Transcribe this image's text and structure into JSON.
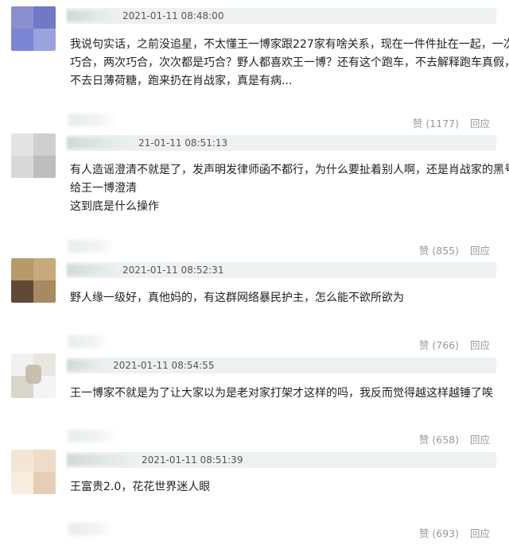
{
  "comments": [
    {
      "time": "2021-01-11 08:48:00",
      "lines": [
        "我说句实话，之前没追星，不太懂王一博家跟227家有啥关系，现在一件件扯在一起，一次",
        "巧合，两次巧合，次次都是巧合？野人都喜欢王一博？还有这个跑车，不去解释跑车真假，",
        "不去日薄荷糖，跑来扔在肖战家，真是有病..."
      ],
      "like_label": "赞",
      "like_count": "(1177)",
      "reply_label": "回应"
    },
    {
      "time": "21-01-11 08:51:13",
      "lines": [
        "有人造谣澄清不就是了，发声明发律师函不都行，为什么要扯着别人啊，还是肖战家的黑号",
        "给王一博澄清",
        "这到底是什么操作"
      ],
      "like_label": "赞",
      "like_count": "(855)",
      "reply_label": "回应"
    },
    {
      "time": "2021-01-11 08:52:31",
      "lines": [
        "野人缘一级好，真他妈的，有这群网络暴民护主，怎么能不欲所欲为"
      ],
      "like_label": "赞",
      "like_count": "(766)",
      "reply_label": "回应"
    },
    {
      "time": "2021-01-11 08:54:55",
      "lines": [
        "王一博家不就是为了让大家以为是老对家打架才这样的吗，我反而觉得越这样越锤了唉"
      ],
      "like_label": "赞",
      "like_count": "(658)",
      "reply_label": "回应"
    },
    {
      "time": "2021-01-11 08:51:39",
      "lines": [
        "王富贵2.0，花花世界迷人眼"
      ],
      "like_label": "赞",
      "like_count": "(693)",
      "reply_label": "回应"
    }
  ],
  "colors": {
    "header_bg": "#eef1f2",
    "time_text": "#555555",
    "action_text": "#999999",
    "body_text": "#222222"
  },
  "icons": [
    "avatar-blurred"
  ]
}
